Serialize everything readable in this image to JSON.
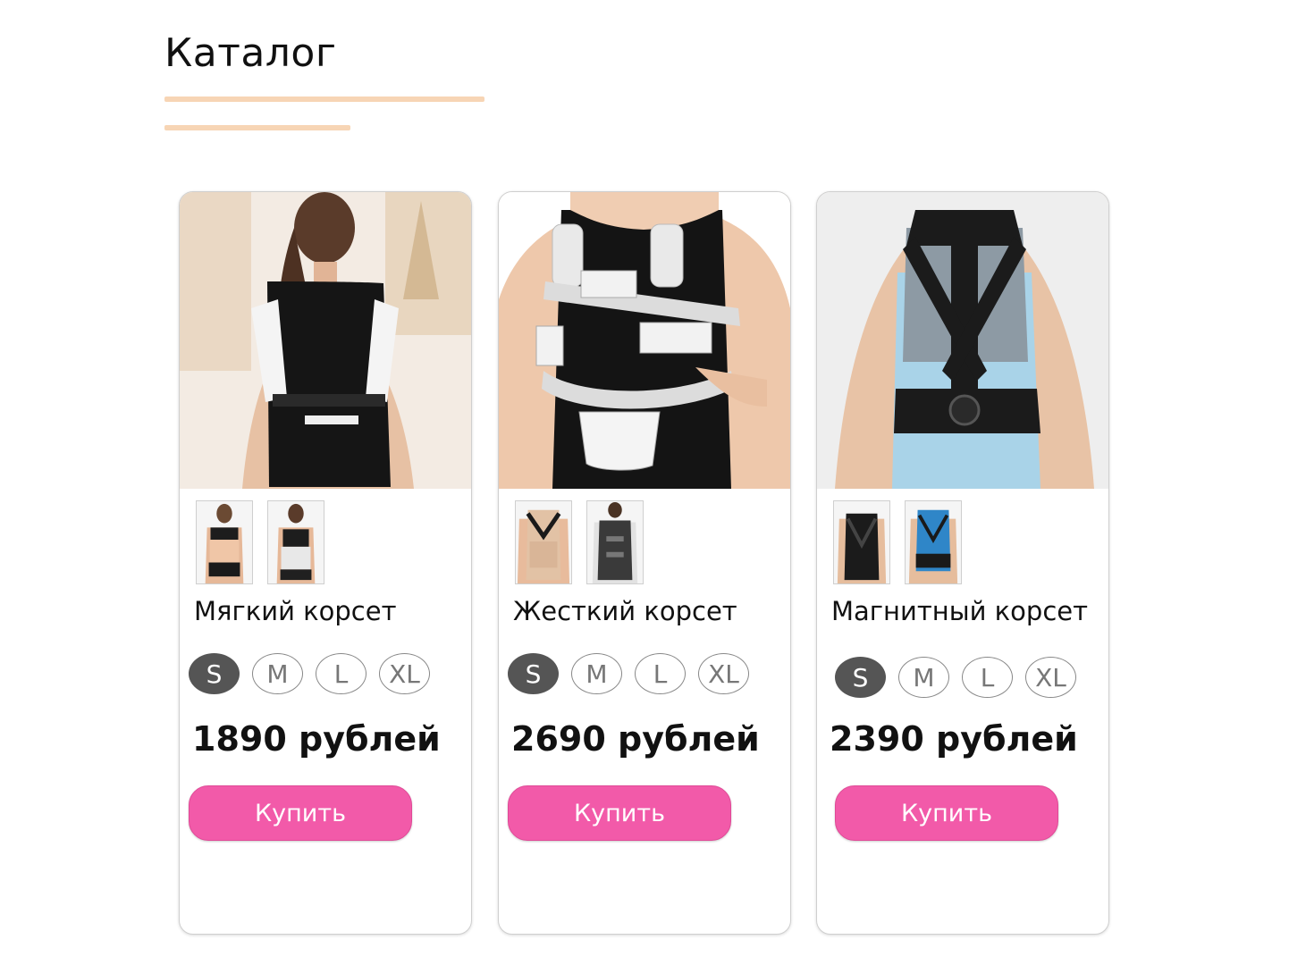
{
  "catalog": {
    "title": "Каталог"
  },
  "colors": {
    "accent_line": "#f7d5b5",
    "buy_button": "#f25aa9",
    "size_active": "#555555"
  },
  "products": [
    {
      "name": "Мягкий корсет",
      "price": "1890 рублей",
      "buy_label": "Купить",
      "sizes": [
        "S",
        "M",
        "L",
        "XL"
      ],
      "selected_size": "S"
    },
    {
      "name": "Жесткий корсет",
      "price": "2690 рублей",
      "buy_label": "Купить",
      "sizes": [
        "S",
        "M",
        "L",
        "XL"
      ],
      "selected_size": "S"
    },
    {
      "name": "Магнитный корсет",
      "price": "2390 рублей",
      "buy_label": "Купить",
      "sizes": [
        "S",
        "M",
        "L",
        "XL"
      ],
      "selected_size": "S"
    }
  ]
}
